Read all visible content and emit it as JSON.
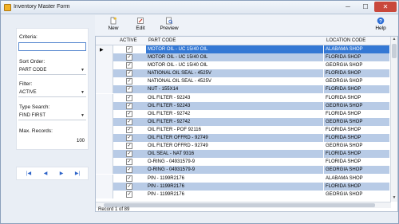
{
  "window": {
    "title": "Inventory Master Form",
    "min_glyph": "─",
    "max_glyph": "☐",
    "close_glyph": "✕"
  },
  "left_panel": {
    "criteria_label": "Criteria:",
    "criteria_value": "",
    "sort_label": "Sort Order:",
    "sort_value": "PART CODE",
    "filter_label": "Filter:",
    "filter_value": "ACTIVE",
    "type_search_label": "Type Search:",
    "type_search_value": "FIND FIRST",
    "max_records_label": "Max. Records:",
    "max_records_value": "100"
  },
  "nav": {
    "first": "|◀",
    "prev": "◀",
    "next": "▶",
    "last": "▶|"
  },
  "toolbar": {
    "new_label": "New",
    "edit_label": "Edit",
    "preview_label": "Preview",
    "help_label": "Help"
  },
  "grid": {
    "headers": {
      "active": "ACTIVE",
      "part_code": "PART CODE",
      "location_code": "LOCATION CODE"
    },
    "rows": [
      {
        "active": true,
        "part": "MOTOR OIL - UC 15/40 OIL",
        "loc": "ALABAMA SHOP"
      },
      {
        "active": true,
        "part": "MOTOR OIL - UC 15/40 OIL",
        "loc": "FLORIDA SHOP"
      },
      {
        "active": true,
        "part": "MOTOR OIL - UC 15/40 OIL",
        "loc": "GEORGIA SHOP"
      },
      {
        "active": true,
        "part": "NATIONAL OIL SEAL - 4525V",
        "loc": "FLORIDA SHOP"
      },
      {
        "active": true,
        "part": "NATIONAL OIL SEAL - 4525V",
        "loc": "GEORGIA SHOP"
      },
      {
        "active": true,
        "part": "NUT - 155X14",
        "loc": "FLORIDA SHOP"
      },
      {
        "active": true,
        "part": "OIL FILTER - 92243",
        "loc": "FLORIDA SHOP"
      },
      {
        "active": true,
        "part": "OIL FILTER - 92243",
        "loc": "GEORGIA SHOP"
      },
      {
        "active": true,
        "part": "OIL FILTER - 92742",
        "loc": "FLORIDA SHOP"
      },
      {
        "active": true,
        "part": "OIL FILTER - 92742",
        "loc": "GEORGIA SHOP"
      },
      {
        "active": true,
        "part": "OIL FILTER - POF 92116",
        "loc": "FLORIDA SHOP"
      },
      {
        "active": true,
        "part": "OIL FILTER OFFRD - 92749",
        "loc": "FLORIDA SHOP"
      },
      {
        "active": true,
        "part": "OIL FILTER OFFRD - 92749",
        "loc": "GEORGIA SHOP"
      },
      {
        "active": true,
        "part": "OIL SEAL - NAT 9316",
        "loc": "FLORIDA SHOP"
      },
      {
        "active": true,
        "part": "O-RING - 04931579-9",
        "loc": "FLORIDA SHOP"
      },
      {
        "active": true,
        "part": "O-RING - 04931579-9",
        "loc": "GEORGIA SHOP"
      },
      {
        "active": true,
        "part": "PIN - 1199R2176",
        "loc": "ALABAMA SHOP"
      },
      {
        "active": true,
        "part": "PIN - 1199R2176",
        "loc": "FLORIDA SHOP"
      },
      {
        "active": true,
        "part": "PIN - 1199R2176",
        "loc": "GEORGIA SHOP"
      }
    ],
    "current_row_marker": "▶",
    "check_glyph": "✓"
  },
  "status": {
    "record_text": "Record 1 of 89"
  },
  "colors": {
    "selected_row": "#3478d4",
    "alt_row": "#b8cbe6",
    "nav_accent": "#2d63c8"
  },
  "icons": [
    "new-document-icon",
    "edit-icon",
    "preview-icon",
    "help-icon",
    "app-icon"
  ]
}
